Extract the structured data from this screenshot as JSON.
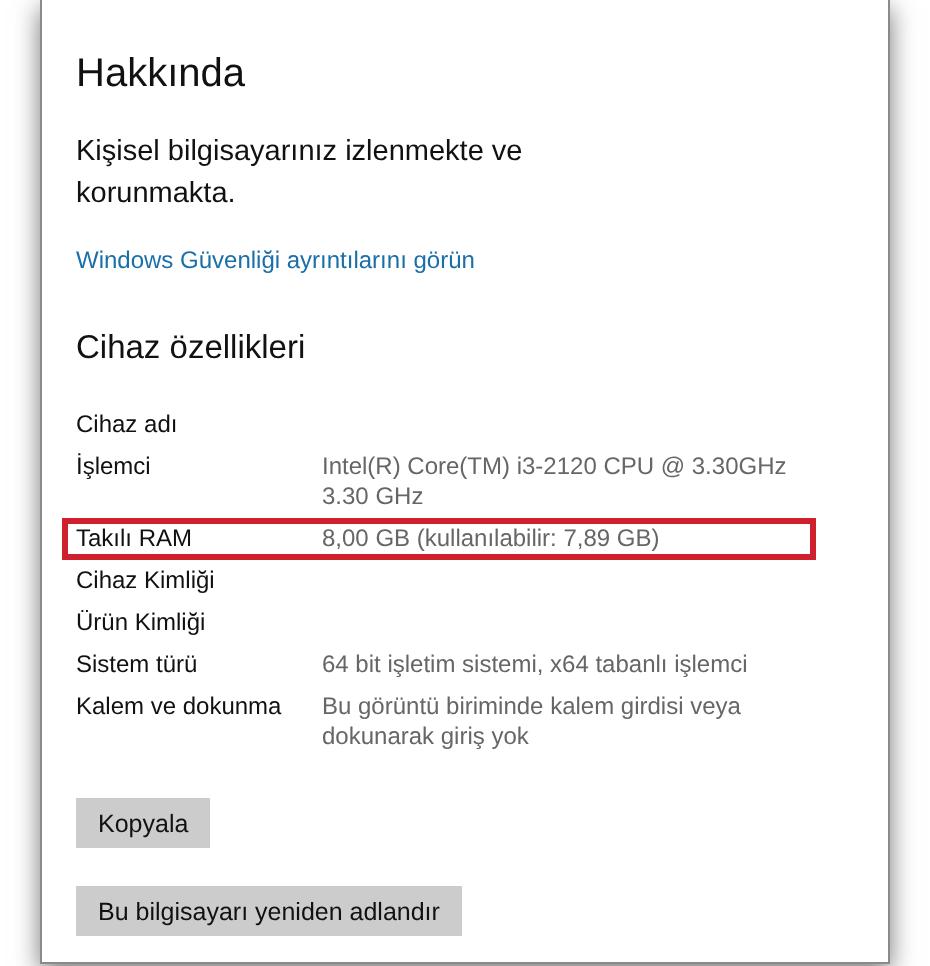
{
  "title": "Hakkında",
  "status": "Kişisel bilgisayarınız izlenmekte ve korunmakta.",
  "link": "Windows Güvenliği ayrıntılarını görün",
  "section_title": "Cihaz özellikleri",
  "specs": [
    {
      "label": "Cihaz adı",
      "highlighted": false
    },
    {
      "label": "İşlemci",
      "value": "Intel(R) Core(TM) i3-2120 CPU @ 3.30GHz 3.30 GHz",
      "highlighted": false
    },
    {
      "label": "Takılı RAM",
      "value": "8,00 GB (kullanılabilir: 7,89 GB)",
      "highlighted": true
    },
    {
      "label": "Cihaz Kimliği",
      "highlighted": false
    },
    {
      "label": "Ürün Kimliği",
      "highlighted": false
    },
    {
      "label": "Sistem türü",
      "value": "64 bit işletim sistemi, x64 tabanlı işlemci",
      "highlighted": false
    },
    {
      "label": "Kalem ve dokunma",
      "value": "Bu görüntü biriminde kalem girdisi veya dokunarak giriş yok",
      "highlighted": false
    }
  ],
  "buttons": [
    "Kopyala",
    "Bu bilgisayarı yeniden adlandır"
  ]
}
